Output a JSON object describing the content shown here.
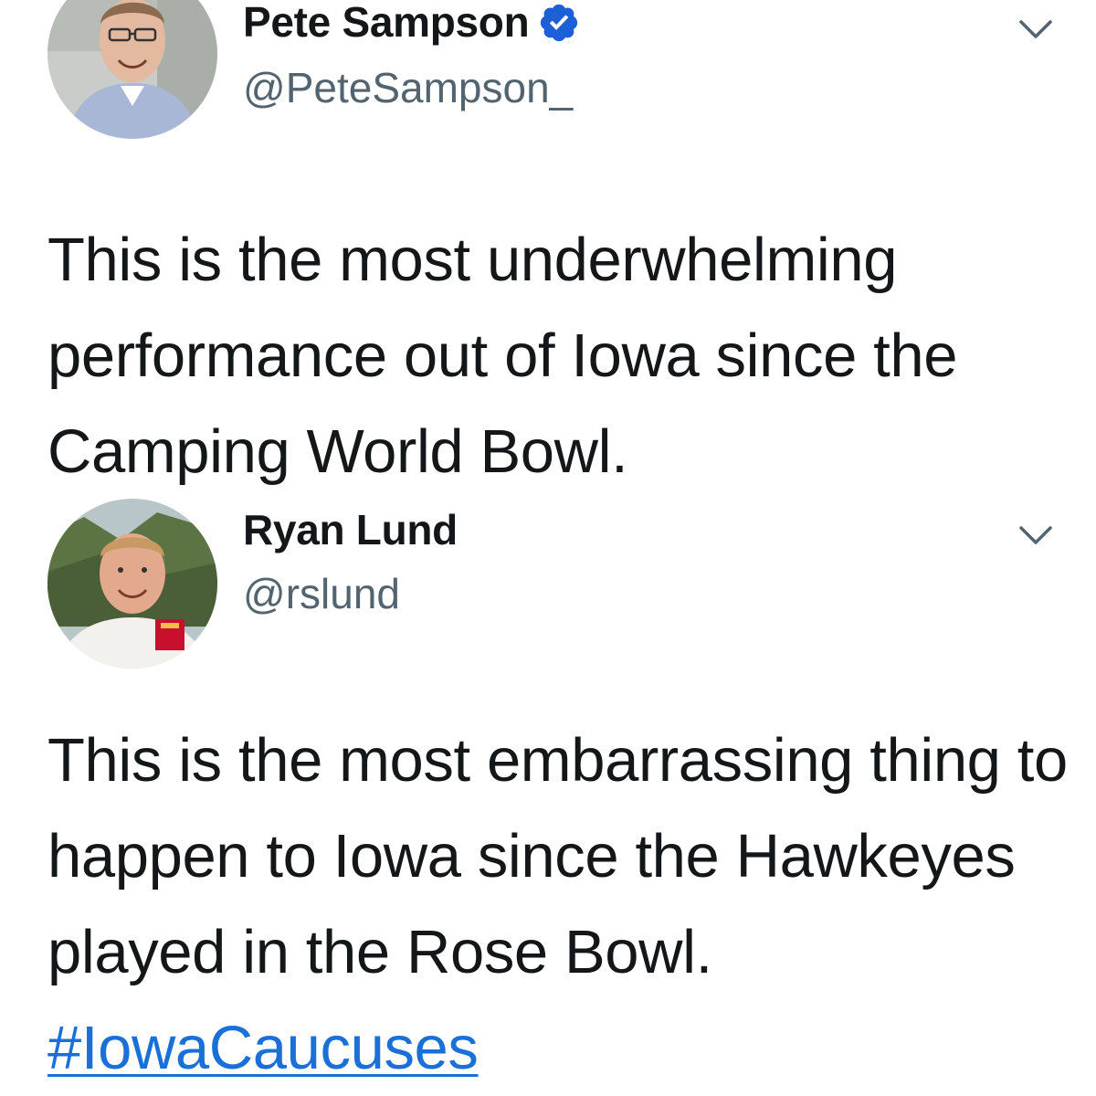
{
  "colors": {
    "text": "#14171a",
    "handle": "#536471",
    "link": "#1b6fd8",
    "verified": "#1d5fd6"
  },
  "tweets": [
    {
      "display_name": "Pete Sampson",
      "handle": "@PeteSampson_",
      "verified": true,
      "menu_icon": "chevron-down-icon",
      "text": "This is the most underwhelming performance out of Iowa since the Camping World Bowl."
    },
    {
      "display_name": "Ryan Lund",
      "handle": "@rslund",
      "verified": false,
      "menu_icon": "chevron-down-icon",
      "text": "This is the most embarrassing thing to happen to Iowa since the Hawkeyes played in the Rose Bowl. ",
      "hashtag": "#IowaCaucuses"
    }
  ]
}
